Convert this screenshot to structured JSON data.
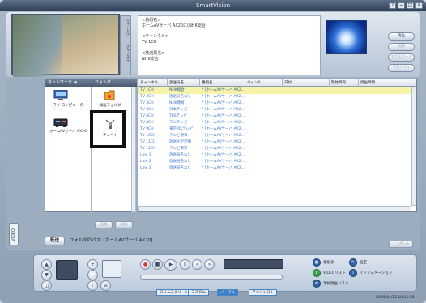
{
  "title": "SmartVision",
  "window_buttons": [
    "?",
    "−",
    "□",
    "×"
  ],
  "video_tabs": [
    "ウィンドウ",
    "チャンネル"
  ],
  "info": {
    "lines": [
      "<番組名>",
      "ホームAVサーバ AX20に(NHK総合",
      "",
      "<チャンネル>",
      "TV 1CH",
      "",
      "<放送局名>",
      "NHK総合"
    ]
  },
  "right_buttons": [
    "再生",
    "削除",
    "エクスポート",
    "プロパティ"
  ],
  "side_tab": "VIDEO",
  "tree": {
    "network_header": "ネットワーク ◀",
    "folder_header": "フォルダ",
    "network_items": [
      {
        "label": "マイ コンピュータ",
        "icon": "computer-icon"
      },
      {
        "label": "ホームAVサーバ AX20",
        "icon": "av-server-icon"
      }
    ],
    "folder_items": [
      {
        "label": "録画フォルダ",
        "icon": "record-folder-icon"
      },
      {
        "label": "チューナ",
        "icon": "tuner-icon"
      }
    ],
    "add_button": "追加",
    "delete_button": "削除"
  },
  "table": {
    "columns": [
      "チャンネル",
      "放送局名",
      "番組名",
      "ジャンル",
      "日付",
      "開始時刻",
      "録画時間"
    ],
    "rows": [
      [
        "TV 1CH",
        "NHK総合",
        "* [ホームAVサーバ AX2..."
      ],
      [
        "TV 3CH",
        "放送局名なし",
        "* [ホームAVサーバ AX2..."
      ],
      [
        "TV 3CH",
        "NHK教育",
        "* [ホームAVサーバ AX2..."
      ],
      [
        "TV 4CH",
        "日本テレビ",
        "* [ホームAVサーバ AX2..."
      ],
      [
        "TV 6CH",
        "TBSテレビ",
        "* [ホームAVサーバ AX2..."
      ],
      [
        "TV 8CH",
        "フジテレビ",
        "* [ホームAVサーバ AX2..."
      ],
      [
        "TV 9CH",
        "東京MXテレビ",
        "* [ホームAVサーバ AX2..."
      ],
      [
        "TV 10CH",
        "テレビ朝日",
        "* [ホームAVサーバ AX2..."
      ],
      [
        "TV 11CH",
        "放送大学学園",
        "* [ホームAVサーバ AX2..."
      ],
      [
        "TV 12CH",
        "テレビ東京",
        "* [ホームAVサーバ AX2..."
      ],
      [
        "Line 1",
        "放送局名なし",
        "* [ホームAVサーバ AX2..."
      ],
      [
        "Line 2",
        "放送局名なし",
        "* [ホームAVサーバ AX2..."
      ],
      [
        "Line 3",
        "放送局名なし",
        "* [ホームAVサーバ AX2..."
      ]
    ],
    "import_button": "インポート"
  },
  "pathbar": {
    "button": "転送",
    "text": "フォルダのパス :[ホームAVサーバ AX20]"
  },
  "controls": {
    "menu_items": [
      {
        "label": "番組表",
        "icon": "program-guide-icon"
      },
      {
        "label": "設定",
        "icon": "settings-icon"
      },
      {
        "label": "VIDEOリスト",
        "icon": "video-list-icon"
      },
      {
        "label": "インフォメーション",
        "icon": "info-icon"
      },
      {
        "label": "予約録画リスト",
        "icon": "reservation-list-icon"
      }
    ],
    "modes": [
      "スリムスクリーン",
      "コスタム",
      "ノーマル",
      "アドバンスト"
    ],
    "active_mode": "ノーマル"
  },
  "clock": "2009/04/21 10:11:28",
  "colors": {
    "accent": "#3f7fc7",
    "title_bg": "#2e3f55",
    "selected_row": "#f7f3a8",
    "text_blue": "#3e79c9"
  }
}
